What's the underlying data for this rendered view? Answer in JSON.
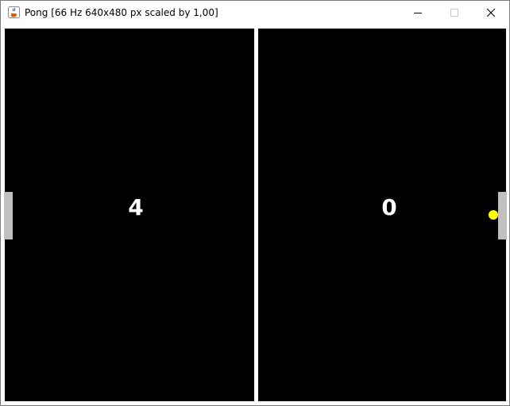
{
  "window": {
    "title": "Pong [66 Hz 640x480 px scaled by 1,00]",
    "icon": "java-cup-icon"
  },
  "titlebar_buttons": {
    "minimize_icon": "minimize-icon",
    "maximize_icon": "maximize-icon",
    "close_icon": "close-icon"
  },
  "game": {
    "score_left": "4",
    "score_right": "0",
    "colors": {
      "field": "#000000",
      "divider": "#ffffff",
      "paddle": "#c0c0c0",
      "ball": "#ffff00",
      "score": "#ffffff"
    }
  }
}
